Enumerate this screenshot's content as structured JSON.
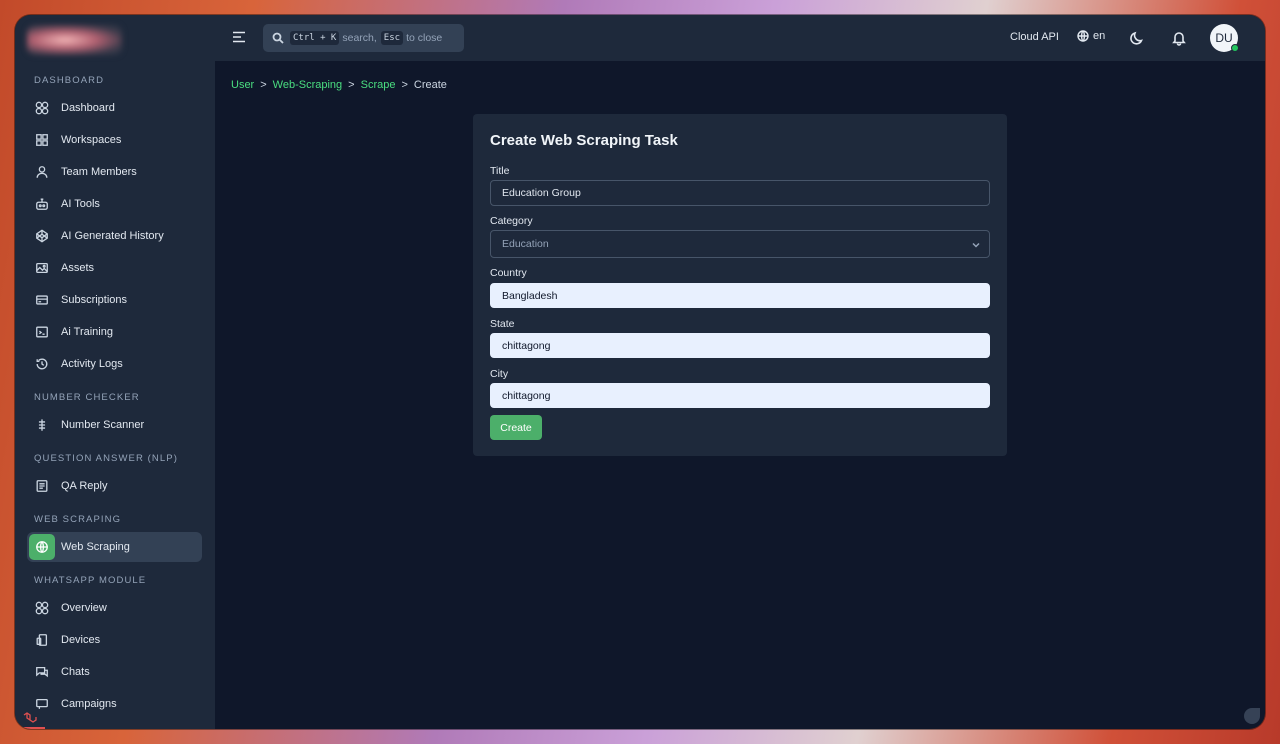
{
  "sidebar": {
    "sections": [
      {
        "label": "DASHBOARD"
      },
      {
        "label": "NUMBER CHECKER"
      },
      {
        "label": "QUESTION ANSWER (NLP)"
      },
      {
        "label": "WEB SCRAPING"
      },
      {
        "label": "WHATSAPP MODULE"
      }
    ],
    "items": [
      {
        "label": "Dashboard",
        "icon": "grid-circles-icon"
      },
      {
        "label": "Workspaces",
        "icon": "grid-squares-icon"
      },
      {
        "label": "Team Members",
        "icon": "user-icon"
      },
      {
        "label": "AI Tools",
        "icon": "robot-icon"
      },
      {
        "label": "AI Generated History",
        "icon": "codepen-icon"
      },
      {
        "label": "Assets",
        "icon": "image-icon"
      },
      {
        "label": "Subscriptions",
        "icon": "card-icon"
      },
      {
        "label": "Ai Training",
        "icon": "training-icon"
      },
      {
        "label": "Activity Logs",
        "icon": "history-icon"
      },
      {
        "label": "Number Scanner",
        "icon": "scanner-icon"
      },
      {
        "label": "QA Reply",
        "icon": "document-icon"
      },
      {
        "label": "Web Scraping",
        "icon": "globe-icon",
        "active": true
      },
      {
        "label": "Overview",
        "icon": "grid-circles-icon"
      },
      {
        "label": "Devices",
        "icon": "devices-icon"
      },
      {
        "label": "Chats",
        "icon": "chat-icon"
      },
      {
        "label": "Campaigns",
        "icon": "campaign-icon"
      }
    ]
  },
  "topbar": {
    "search": {
      "kbd1": "Ctrl + K",
      "text1": "search,",
      "kbd2": "Esc",
      "text2": "to close"
    },
    "cloud_api": "Cloud API",
    "language": "en",
    "avatar_initials": "DU"
  },
  "breadcrumb": {
    "items": [
      "User",
      "Web-Scraping",
      "Scrape"
    ],
    "current": "Create",
    "separator": ">"
  },
  "form": {
    "title": "Create Web Scraping Task",
    "fields": {
      "title": {
        "label": "Title",
        "value": "Education Group"
      },
      "category": {
        "label": "Category",
        "value": "Education"
      },
      "country": {
        "label": "Country",
        "value": "Bangladesh"
      },
      "state": {
        "label": "State",
        "value": "chittagong"
      },
      "city": {
        "label": "City",
        "value": "chittagong"
      }
    },
    "submit_label": "Create"
  },
  "colors": {
    "accent": "#4caf6a",
    "link": "#4ade80",
    "bg": "#0f172a",
    "panel": "#1e293b"
  }
}
